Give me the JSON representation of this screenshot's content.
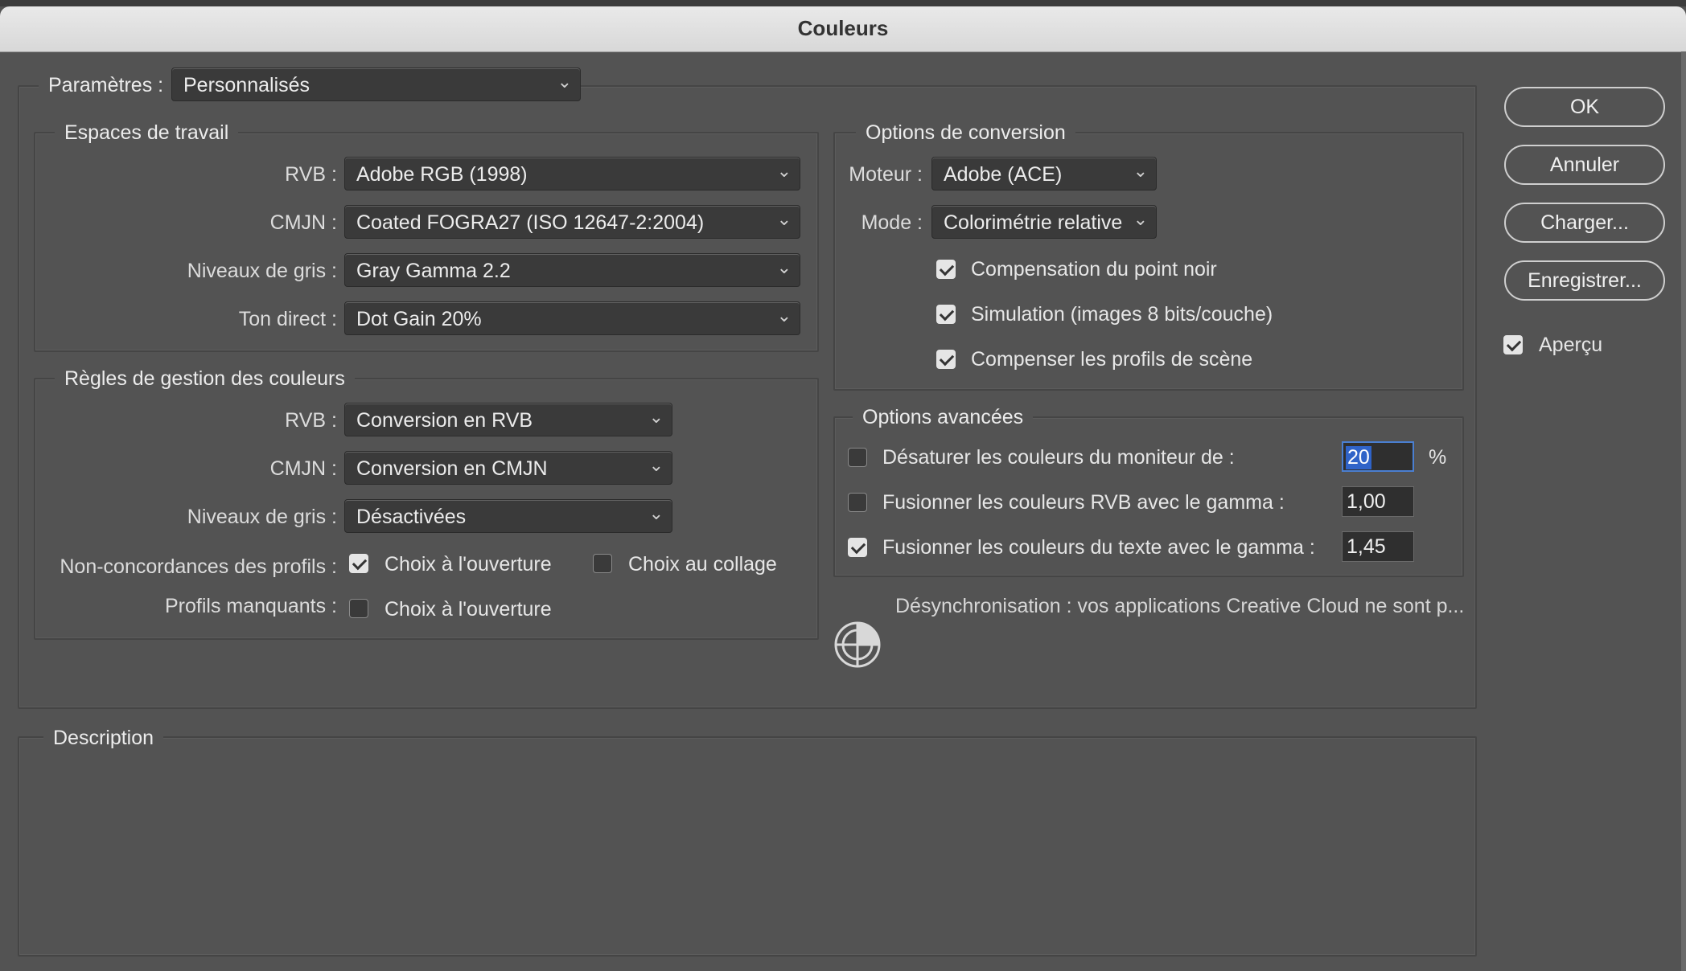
{
  "window": {
    "title": "Couleurs"
  },
  "settings": {
    "label": "Paramètres :",
    "value": "Personnalisés"
  },
  "working_spaces": {
    "title": "Espaces de travail",
    "rows": [
      {
        "label": "RVB :",
        "value": "Adobe RGB (1998)"
      },
      {
        "label": "CMJN :",
        "value": "Coated FOGRA27 (ISO 12647-2:2004)"
      },
      {
        "label": "Niveaux de gris :",
        "value": "Gray Gamma 2.2"
      },
      {
        "label": "Ton direct :",
        "value": "Dot Gain 20%"
      }
    ]
  },
  "policies": {
    "title": "Règles de gestion des couleurs",
    "rows": [
      {
        "label": "RVB :",
        "value": "Conversion en RVB"
      },
      {
        "label": "CMJN :",
        "value": "Conversion en CMJN"
      },
      {
        "label": "Niveaux de gris :",
        "value": "Désactivées"
      }
    ],
    "mismatch_label": "Non-concordances des profils :",
    "mismatch_open": {
      "label": "Choix à l'ouverture",
      "checked": true
    },
    "mismatch_paste": {
      "label": "Choix au collage",
      "checked": false
    },
    "missing_label": "Profils manquants :",
    "missing_open": {
      "label": "Choix à l'ouverture",
      "checked": false
    }
  },
  "conversion": {
    "title": "Options de conversion",
    "engine_label": "Moteur :",
    "engine_value": "Adobe (ACE)",
    "mode_label": "Mode :",
    "mode_value": "Colorimétrie relative",
    "checks": [
      {
        "label": "Compensation du point noir",
        "checked": true
      },
      {
        "label": "Simulation (images 8 bits/couche)",
        "checked": true
      },
      {
        "label": "Compenser les profils de scène",
        "checked": true
      }
    ]
  },
  "advanced": {
    "title": "Options avancées",
    "rows": [
      {
        "label": "Désaturer les couleurs du moniteur de :",
        "value": "20",
        "unit": "%",
        "checked": false
      },
      {
        "label": "Fusionner les couleurs RVB avec le gamma :",
        "value": "1,00",
        "checked": false
      },
      {
        "label": "Fusionner les couleurs du texte avec le gamma :",
        "value": "1,45",
        "checked": true
      }
    ]
  },
  "sync": {
    "message": "Désynchronisation : vos applications Creative Cloud ne sont p...",
    "icon": "sync-status-icon"
  },
  "description": {
    "title": "Description"
  },
  "buttons": {
    "ok": "OK",
    "cancel": "Annuler",
    "load": "Charger...",
    "save": "Enregistrer..."
  },
  "preview": {
    "label": "Aperçu",
    "checked": true
  },
  "colors": {
    "background": "#535353",
    "focus": "#4a7fd1",
    "selection": "#2f63c8"
  }
}
